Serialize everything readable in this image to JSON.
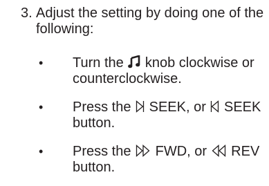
{
  "step": {
    "number": "3.",
    "text": "Adjust the setting by doing one of the following:"
  },
  "bullets": [
    {
      "marker": "•",
      "before": "Turn the",
      "icon": "music-note-icon",
      "after": "knob clockwise or counterclockwise."
    },
    {
      "marker": "•",
      "before": "Press the",
      "icon1": "seek-forward-icon",
      "middle": "SEEK, or",
      "icon2": "seek-back-icon",
      "after": "SEEK button."
    },
    {
      "marker": "•",
      "before": "Press the",
      "icon1": "fast-forward-icon",
      "middle": "FWD, or",
      "icon2": "rewind-icon",
      "after": "REV button."
    }
  ]
}
